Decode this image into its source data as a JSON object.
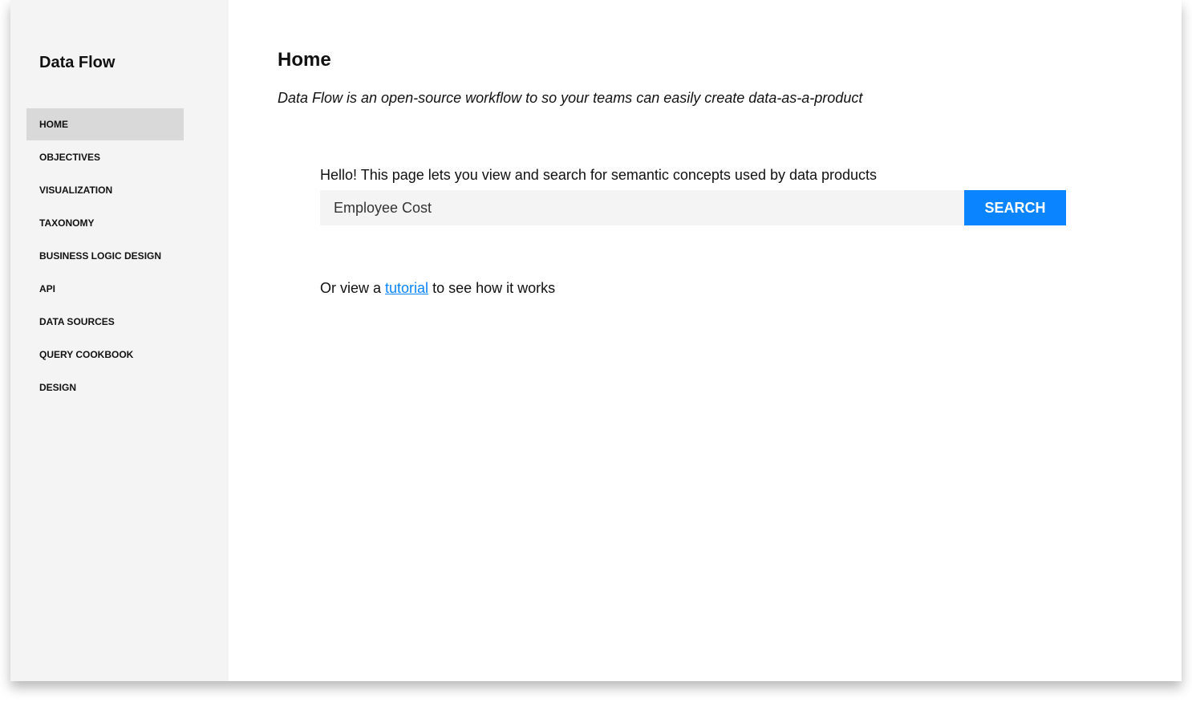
{
  "sidebar": {
    "app_title": "Data Flow",
    "items": [
      {
        "label": "HOME",
        "active": true
      },
      {
        "label": "OBJECTIVES",
        "active": false
      },
      {
        "label": "VISUALIZATION",
        "active": false
      },
      {
        "label": "TAXONOMY",
        "active": false
      },
      {
        "label": "BUSINESS LOGIC DESIGN",
        "active": false
      },
      {
        "label": "API",
        "active": false
      },
      {
        "label": "DATA SOURCES",
        "active": false
      },
      {
        "label": "QUERY COOKBOOK",
        "active": false
      },
      {
        "label": "DESIGN",
        "active": false
      }
    ]
  },
  "main": {
    "title": "Home",
    "tagline": "Data Flow is an open-source workflow to so your teams can easily create data-as-a-product",
    "intro": "Hello! This page lets you view and search for semantic concepts used by data products",
    "search": {
      "value": "Employee Cost",
      "button_label": "SEARCH"
    },
    "tutorial": {
      "prefix": "Or view a ",
      "link_label": "tutorial",
      "suffix": " to see how it works"
    }
  },
  "colors": {
    "accent": "#0a84ff",
    "sidebar_bg": "#f4f4f4",
    "active_item_bg": "#d9d9d9",
    "input_bg": "#f4f4f4"
  }
}
